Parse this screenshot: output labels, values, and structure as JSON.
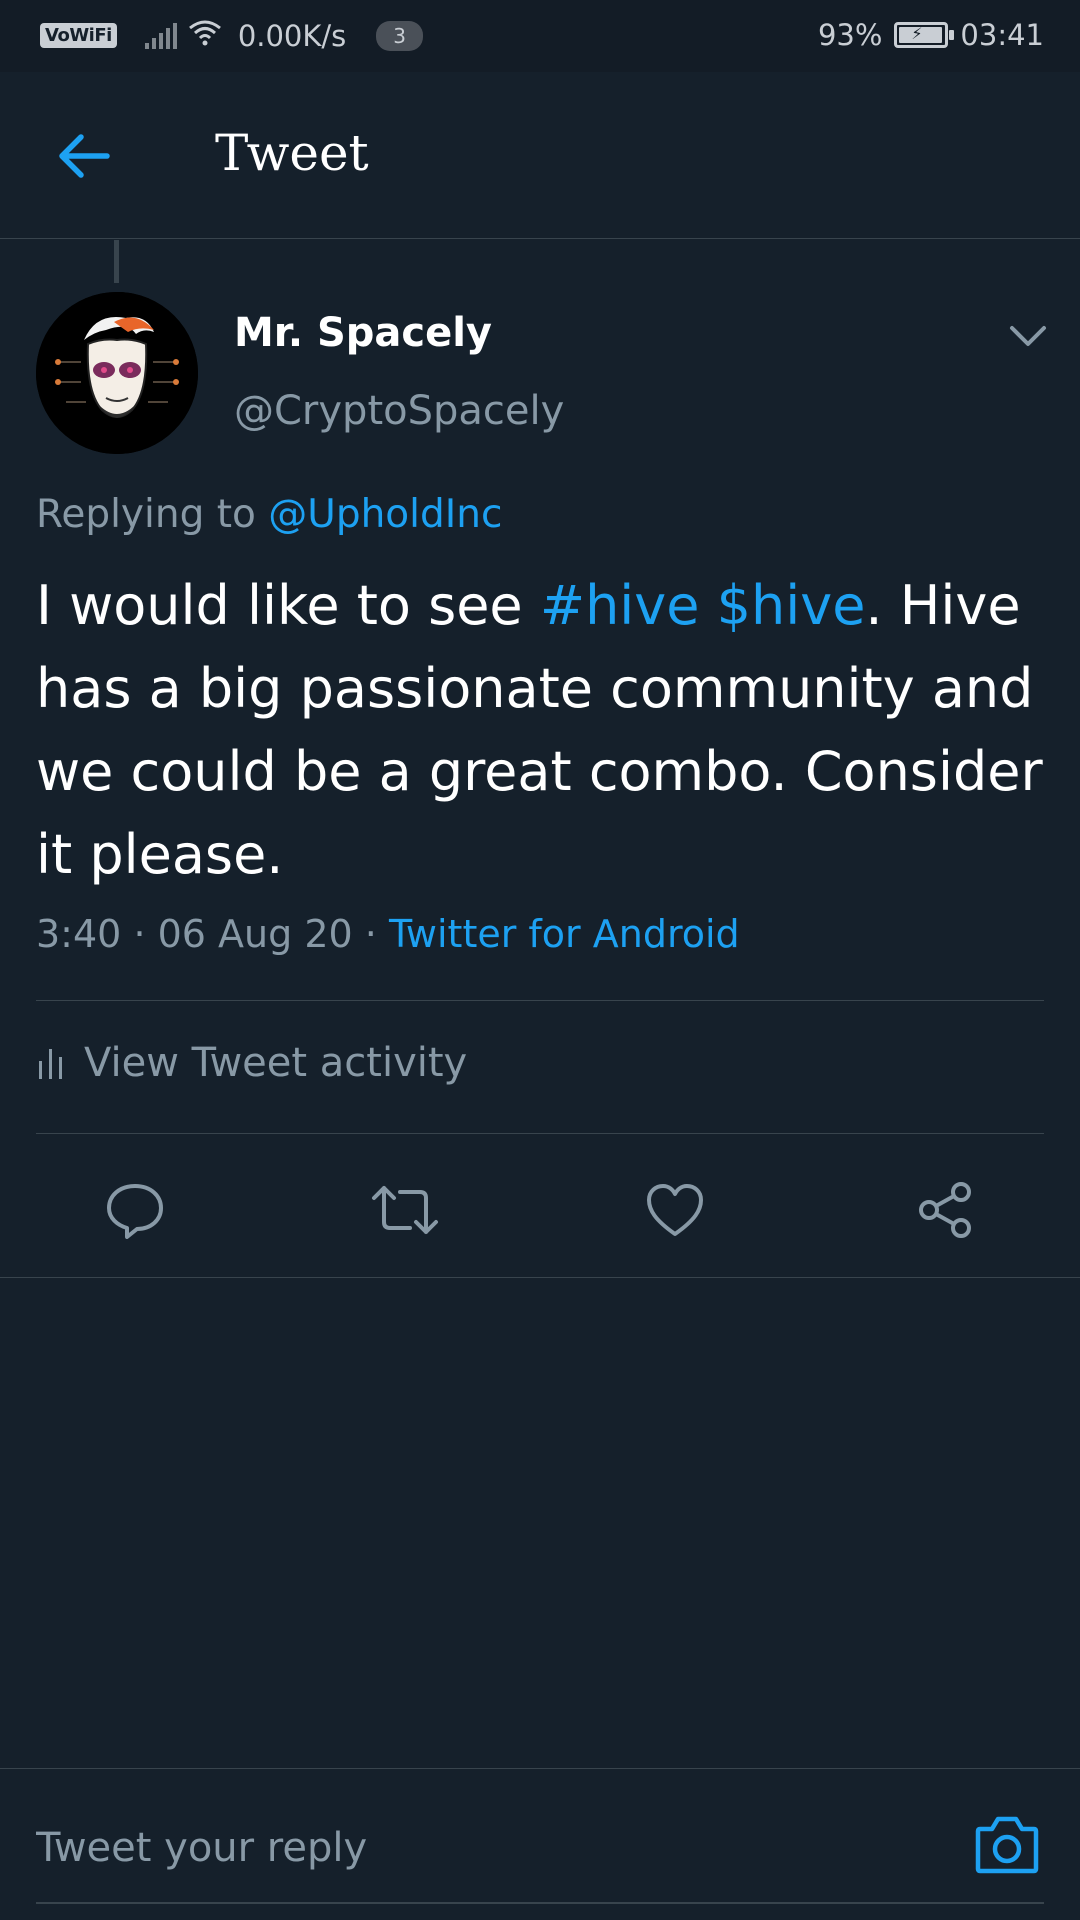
{
  "status_bar": {
    "vowifi": "VoWiFi",
    "net_speed": "0.00K/s",
    "notification_count": "3",
    "battery_percent": "93%",
    "time": "03:41"
  },
  "header": {
    "title": "Tweet",
    "back_icon": "arrow-left-icon"
  },
  "tweet": {
    "display_name": "Mr. Spacely",
    "handle": "@CryptoSpacely",
    "replying_prefix": "Replying to",
    "replying_to": "@UpholdInc",
    "text_part1": "I would like to see ",
    "hashtag": "#hive",
    "cashtag": "$hive",
    "text_part2": ". Hive has a big passionate community and we could be a great combo. Consider it please.",
    "time": "3:40",
    "date": "06 Aug 20",
    "separator": "·",
    "source": "Twitter for Android"
  },
  "activity": {
    "label": "View Tweet activity"
  },
  "actions": {
    "icons": [
      "reply-icon",
      "retweet-icon",
      "like-icon",
      "share-icon"
    ]
  },
  "reply_bar": {
    "placeholder": "Tweet your reply"
  },
  "colors": {
    "background": "#15202b",
    "accent": "#1da1f2",
    "muted": "#8899a6",
    "divider": "#38444d"
  }
}
